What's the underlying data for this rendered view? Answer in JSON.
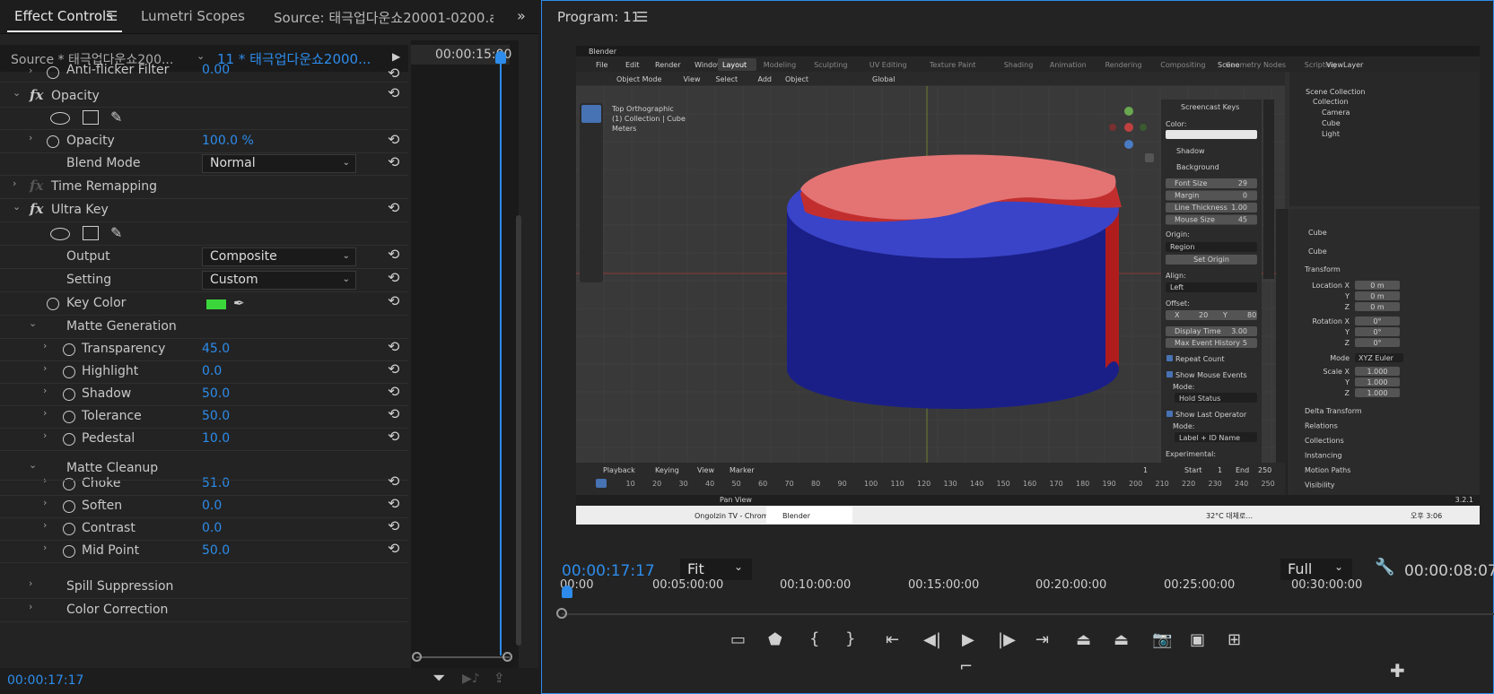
{
  "effect_controls": {
    "tabs": [
      "Effect Controls",
      "Lumetri Scopes",
      "Source: 태극업다운쇼20001-0200.av"
    ],
    "source_label": "Source * 태극업다운쇼200...",
    "sequence_label": "11 * 태극업다운쇼2000...",
    "timeline_time": "00:00:15:00",
    "footer_time": "00:00:17:17",
    "rows": {
      "antiflicker": {
        "label": "Anti-flicker Filter",
        "value": "0.00"
      },
      "opacity_group": "Opacity",
      "opacity": {
        "label": "Opacity",
        "value": "100.0 %"
      },
      "blend_mode": {
        "label": "Blend Mode",
        "value": "Normal"
      },
      "time_remap": "Time Remapping",
      "ultra_key": "Ultra Key",
      "output": {
        "label": "Output",
        "value": "Composite"
      },
      "setting": {
        "label": "Setting",
        "value": "Custom"
      },
      "key_color": {
        "label": "Key Color",
        "color": "#3bd63b"
      },
      "matte_gen": "Matte Generation",
      "transparency": {
        "label": "Transparency",
        "value": "45.0"
      },
      "highlight": {
        "label": "Highlight",
        "value": "0.0"
      },
      "shadow": {
        "label": "Shadow",
        "value": "50.0"
      },
      "tolerance": {
        "label": "Tolerance",
        "value": "50.0"
      },
      "pedestal": {
        "label": "Pedestal",
        "value": "10.0"
      },
      "matte_clean": "Matte Cleanup",
      "choke": {
        "label": "Choke",
        "value": "51.0"
      },
      "soften": {
        "label": "Soften",
        "value": "0.0"
      },
      "contrast": {
        "label": "Contrast",
        "value": "0.0"
      },
      "midpoint": {
        "label": "Mid Point",
        "value": "50.0"
      },
      "spill": "Spill Suppression",
      "color_corr": "Color Correction"
    }
  },
  "program": {
    "title": "Program: 11",
    "current_time": "00:00:17:17",
    "fit": "Fit",
    "quality": "Full",
    "duration": "00:00:08:07",
    "ruler": [
      "00:00",
      "00:05:00:00",
      "00:10:00:00",
      "00:15:00:00",
      "00:20:00:00",
      "00:25:00:00",
      "00:30:00:00"
    ]
  },
  "blender": {
    "title": "Blender",
    "menu": [
      "File",
      "Edit",
      "Render",
      "Window",
      "Help"
    ],
    "workspaces": [
      "Layout",
      "Modeling",
      "Sculpting",
      "UV Editing",
      "Texture Paint",
      "Shading",
      "Animation",
      "Rendering",
      "Compositing",
      "Geometry Nodes",
      "Scripting"
    ],
    "scene": "Scene",
    "view_layer": "ViewLayer",
    "header": [
      "Object Mode",
      "View",
      "Select",
      "Add",
      "Object"
    ],
    "global": "Global",
    "options": "Options",
    "overlay": [
      "Top Orthographic",
      "(1) Collection | Cube",
      "Meters"
    ],
    "screencast": {
      "title": "Screencast Keys",
      "color": "Color:",
      "shadow": "Shadow",
      "background": "Background",
      "fields": [
        [
          "Font Size",
          "29"
        ],
        [
          "Margin",
          "0"
        ],
        [
          "Line Thickness",
          "1.00"
        ],
        [
          "Mouse Size",
          "45"
        ]
      ],
      "origin_label": "Origin:",
      "origin": "Region",
      "set_origin": "Set Origin",
      "align_label": "Align:",
      "align": "Left",
      "offset_label": "Offset:",
      "offset": [
        "X",
        "20",
        "Y",
        "80"
      ],
      "display_time": [
        "Display Time",
        "3.00"
      ],
      "max_event": [
        "Max Event History",
        "5"
      ],
      "repeat": "Repeat Count",
      "mouse_events": "Show Mouse Events",
      "mode_label": "Mode:",
      "mouse_mode": "Hold Status",
      "last_op": "Show Last Operator",
      "last_mode": "Label + ID Name",
      "experimental": "Experimental:"
    },
    "sidebar_tabs": [
      "Item",
      "Tool",
      "View",
      "BlenderKit",
      "Screencast Keys"
    ],
    "outliner": {
      "title": "Scene Collection",
      "items": [
        "Collection",
        "Camera",
        "Cube",
        "Light"
      ]
    },
    "props": {
      "object": "Cube",
      "object2": "Cube",
      "transform": "Transform",
      "location": [
        [
          "Location X",
          "0 m"
        ],
        [
          "Y",
          "0 m"
        ],
        [
          "Z",
          "0 m"
        ]
      ],
      "rotation": [
        [
          "Rotation X",
          "0°"
        ],
        [
          "Y",
          "0°"
        ],
        [
          "Z",
          "0°"
        ]
      ],
      "mode": [
        "Mode",
        "XYZ Euler"
      ],
      "scale": [
        [
          "Scale X",
          "1.000"
        ],
        [
          "Y",
          "1.000"
        ],
        [
          "Z",
          "1.000"
        ]
      ],
      "sections": [
        "Delta Transform",
        "Relations",
        "Collections",
        "Instancing",
        "Motion Paths",
        "Visibility"
      ]
    },
    "timeline": {
      "menu": [
        "Playback",
        "Keying",
        "View",
        "Marker"
      ],
      "frame": "1",
      "start": [
        "Start",
        "1"
      ],
      "end": [
        "End",
        "250"
      ],
      "ticks": [
        "1",
        "10",
        "20",
        "30",
        "40",
        "50",
        "60",
        "70",
        "80",
        "90",
        "100",
        "110",
        "120",
        "130",
        "140",
        "150",
        "160",
        "170",
        "180",
        "190",
        "200",
        "210",
        "220",
        "230",
        "240",
        "250"
      ]
    },
    "status": [
      "Pan View",
      "3.2.1"
    ],
    "taskbar": [
      "Ongolzin TV - Chrome",
      "Blender",
      "32°C 대체로...",
      "오후 3:06"
    ]
  }
}
